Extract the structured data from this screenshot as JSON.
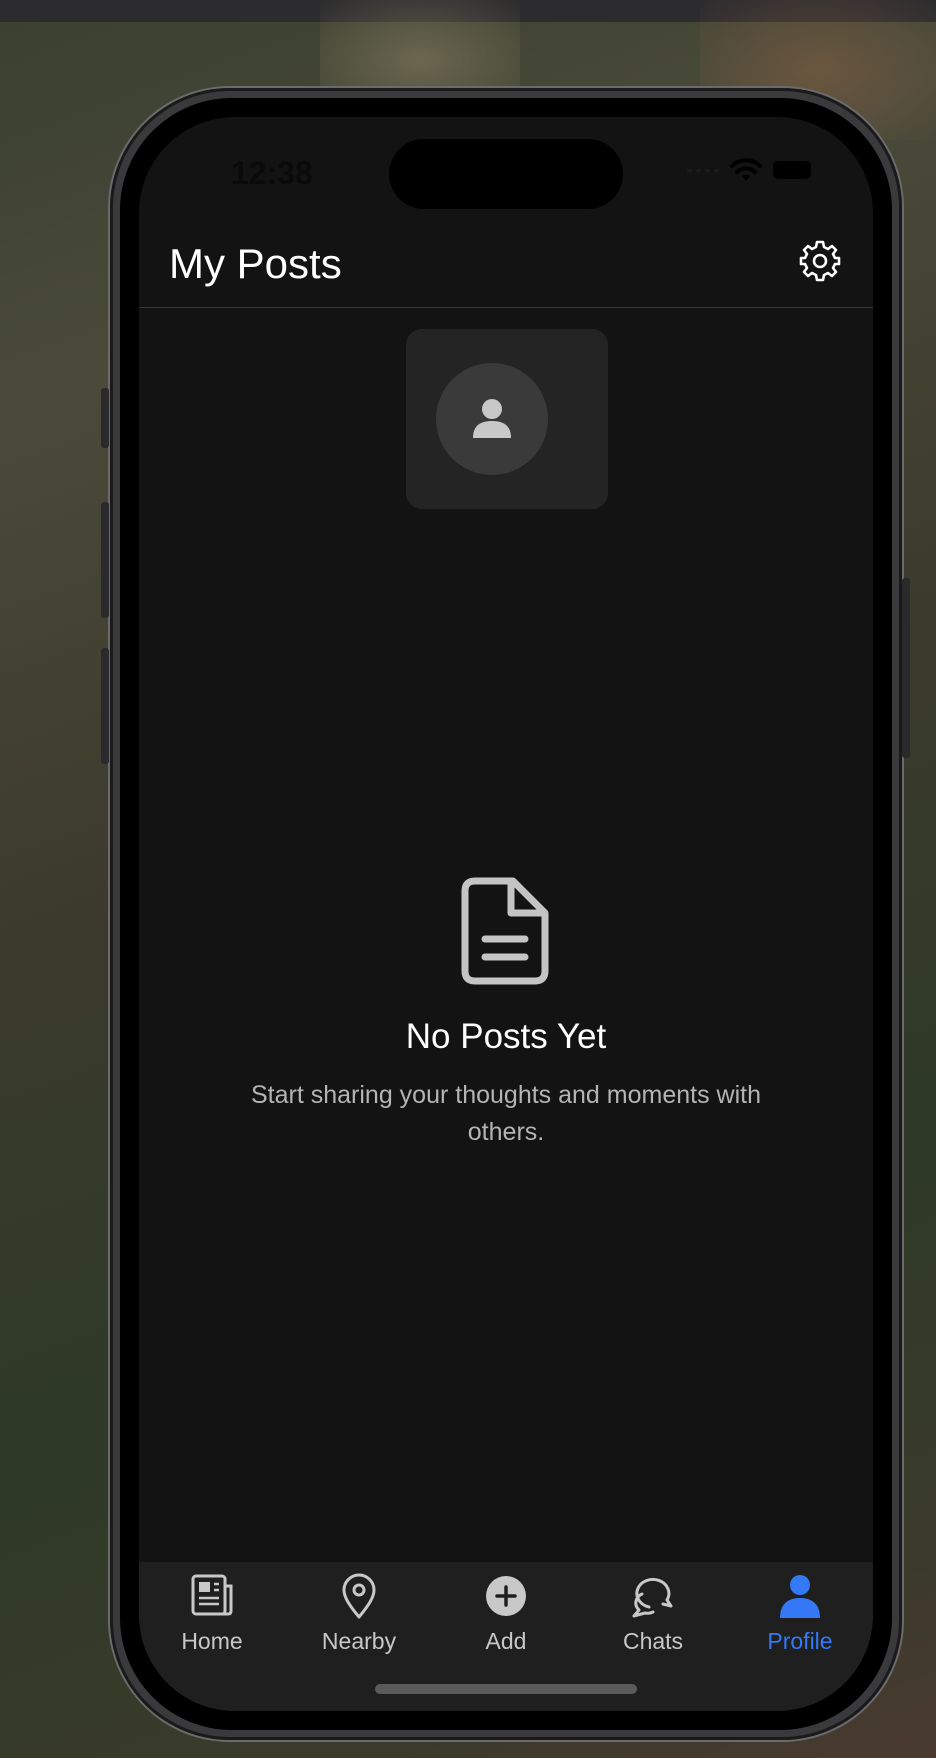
{
  "status_bar": {
    "time": "12:38"
  },
  "header": {
    "title": "My Posts",
    "settings_icon": "gear-icon"
  },
  "profile": {
    "avatar_icon": "person-icon"
  },
  "empty_state": {
    "icon": "document-icon",
    "title": "No Posts Yet",
    "subtitle": "Start sharing your thoughts and moments with others."
  },
  "tab_bar": {
    "active_color": "#3478f6",
    "tabs": [
      {
        "label": "Home",
        "icon": "newspaper-icon",
        "active": false
      },
      {
        "label": "Nearby",
        "icon": "location-pin-icon",
        "active": false
      },
      {
        "label": "Add",
        "icon": "plus-circle-icon",
        "active": false
      },
      {
        "label": "Chats",
        "icon": "chat-bubbles-icon",
        "active": false
      },
      {
        "label": "Profile",
        "icon": "person-icon",
        "active": true
      }
    ]
  }
}
